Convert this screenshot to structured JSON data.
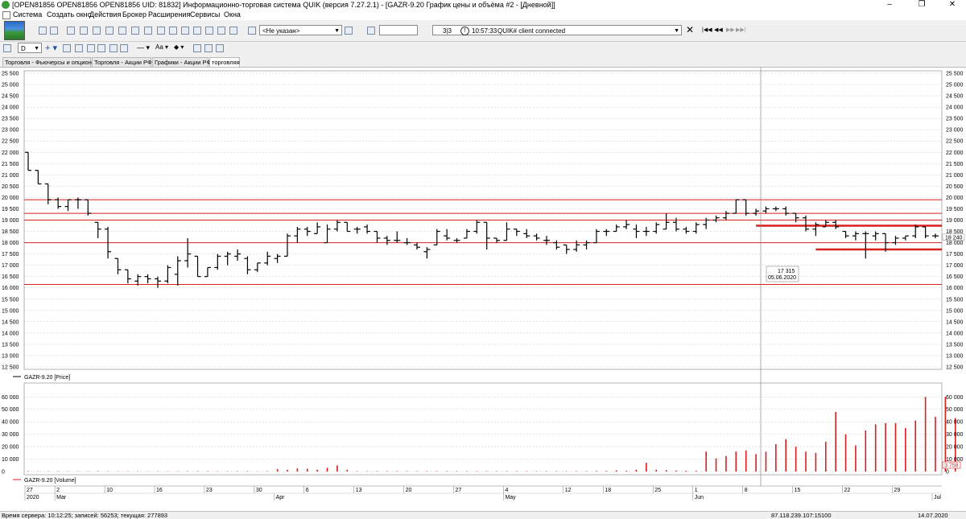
{
  "window": {
    "title": "[OPEN81856 OPEN81856 OPEN81856 UID: 81832] Информационно-торговая система QUIK (версия 7.27.2.1) - [GAZR-9.20 График цены и объёма #2 - [Дневной]]",
    "minimize": "–",
    "restore": "❐",
    "close": "✕"
  },
  "menu": [
    "Система",
    "Создать окно",
    "Действия",
    "Брокер",
    "Расширения",
    "Сервисы",
    "Окна"
  ],
  "toolbar": {
    "account_select": "<Не указан>",
    "search_value": "",
    "message_counter": "3|3",
    "message_time": "10:57:33",
    "message_text": "QUIK# client connected"
  },
  "toolbar2": {
    "interval": "D"
  },
  "tabs": [
    {
      "label": "Торговля - Фьючерсы и опционы",
      "active": false
    },
    {
      "label": "Торговля - Акции РФ",
      "active": false
    },
    {
      "label": "Графики - Акции РФ",
      "active": false
    },
    {
      "label": "торговляя",
      "active": true
    }
  ],
  "chart_data": [
    {
      "type": "ohlc",
      "legend": "GAZR-9.20 [Price]",
      "ylim": [
        12500,
        25500
      ],
      "y_ticks": [
        25500,
        25000,
        24500,
        24000,
        23500,
        23000,
        22500,
        22000,
        21500,
        21000,
        20500,
        20000,
        19500,
        19000,
        18500,
        18000,
        17500,
        17000,
        16500,
        16000,
        15500,
        15000,
        14500,
        14000,
        13500,
        13000,
        12500
      ],
      "right_axis_ticks": [
        25500,
        25000,
        24500,
        24000,
        23500,
        23000,
        22500,
        22000,
        21500,
        21000,
        20500,
        20000,
        19500,
        19000,
        18500,
        18000,
        17500,
        17000,
        16500,
        16000,
        15500,
        15000,
        14500,
        14000,
        13500,
        13000,
        12500
      ],
      "right_axis_labels": [
        "25 500",
        "25 000",
        "24 500",
        "24 000",
        "23 500",
        "23 000",
        "22 500",
        "22 000",
        "21 500",
        "21 000",
        "20 500",
        "20 000",
        "19 500",
        "19 000",
        "18 500",
        "18 000",
        "17 500",
        "17 000",
        "16 500",
        "16 000",
        "15 500",
        "15 000",
        "14 500",
        "14 000",
        "13 500",
        "13 000",
        "12 500"
      ],
      "last_price_label": "18 240",
      "last_price": 18240,
      "crosshair": {
        "value_label": "17 315",
        "date_label": "05.06.2020"
      },
      "horizontal_levels": [
        19900,
        19300,
        19000,
        18000,
        16150
      ],
      "horizontal_levels_thick": [
        {
          "value": 18750,
          "from_bar": 73,
          "to_bar": 82
        },
        {
          "value": 17700,
          "from_bar": 79,
          "to_bar": 83
        }
      ],
      "bars": [
        [
          22000,
          22000,
          21200,
          21200
        ],
        [
          21200,
          21200,
          20600,
          20600
        ],
        [
          20600,
          20600,
          19700,
          19900
        ],
        [
          19900,
          20000,
          19500,
          19600
        ],
        [
          19600,
          19900,
          19400,
          19900
        ],
        [
          19900,
          20000,
          19500,
          19900
        ],
        [
          19900,
          19900,
          19200,
          19300
        ],
        [
          18900,
          18900,
          18200,
          18600
        ],
        [
          18600,
          18700,
          17300,
          17600
        ],
        [
          17300,
          17300,
          16600,
          16800
        ],
        [
          16800,
          16800,
          16200,
          16400
        ],
        [
          16300,
          16600,
          16100,
          16500
        ],
        [
          16500,
          16600,
          16200,
          16400
        ],
        [
          16400,
          16500,
          16000,
          16300
        ],
        [
          16300,
          17000,
          16200,
          16900
        ],
        [
          16600,
          17400,
          16100,
          17200
        ],
        [
          17200,
          18200,
          16900,
          17500
        ],
        [
          17400,
          17400,
          16500,
          16500
        ],
        [
          16500,
          16900,
          16500,
          16900
        ],
        [
          16900,
          17500,
          16800,
          17400
        ],
        [
          17400,
          17600,
          17000,
          17500
        ],
        [
          17400,
          17700,
          17200,
          17500
        ],
        [
          17300,
          17400,
          16600,
          16800
        ],
        [
          16800,
          17100,
          16700,
          17100
        ],
        [
          17100,
          17600,
          17000,
          17400
        ],
        [
          17300,
          17500,
          17100,
          17400
        ],
        [
          17400,
          18400,
          17400,
          18300
        ],
        [
          18300,
          18700,
          18000,
          18600
        ],
        [
          18600,
          18700,
          18300,
          18500
        ],
        [
          18400,
          18900,
          18400,
          18700
        ],
        [
          18000,
          18800,
          18000,
          18600
        ],
        [
          18600,
          19000,
          18500,
          18900
        ],
        [
          18900,
          18900,
          18500,
          18500
        ],
        [
          18600,
          18700,
          18400,
          18600
        ],
        [
          18700,
          18800,
          18400,
          18500
        ],
        [
          18500,
          18500,
          18000,
          18200
        ],
        [
          18200,
          18300,
          17900,
          18100
        ],
        [
          18100,
          18500,
          18000,
          18100
        ],
        [
          18000,
          18200,
          17900,
          18000
        ],
        [
          17900,
          18000,
          17700,
          17800
        ],
        [
          17600,
          17800,
          17300,
          17700
        ],
        [
          17900,
          18600,
          17900,
          18500
        ],
        [
          18300,
          18600,
          18100,
          18200
        ],
        [
          18100,
          18200,
          18000,
          18100
        ],
        [
          18200,
          18600,
          18200,
          18500
        ],
        [
          18500,
          19000,
          18400,
          18900
        ],
        [
          18900,
          18900,
          17700,
          18200
        ],
        [
          18200,
          18200,
          18000,
          18100
        ],
        [
          18100,
          18900,
          18100,
          18600
        ],
        [
          18600,
          18600,
          18300,
          18500
        ],
        [
          18400,
          18600,
          18200,
          18300
        ],
        [
          18300,
          18400,
          18100,
          18200
        ],
        [
          18100,
          18300,
          17900,
          18100
        ],
        [
          18000,
          18100,
          17700,
          17800
        ],
        [
          17900,
          17900,
          17500,
          17700
        ],
        [
          17700,
          18100,
          17600,
          17900
        ],
        [
          17900,
          18100,
          17700,
          18000
        ],
        [
          18000,
          18600,
          18000,
          18500
        ],
        [
          18500,
          18600,
          18300,
          18500
        ],
        [
          18500,
          18800,
          18500,
          18700
        ],
        [
          18700,
          19000,
          18600,
          18800
        ],
        [
          18600,
          18800,
          18200,
          18500
        ],
        [
          18500,
          18700,
          18300,
          18500
        ],
        [
          18500,
          18900,
          18400,
          18800
        ],
        [
          18600,
          19300,
          18600,
          18900
        ],
        [
          18900,
          19100,
          18500,
          18600
        ],
        [
          18600,
          18700,
          18400,
          18500
        ],
        [
          18500,
          18900,
          18400,
          18800
        ],
        [
          18800,
          19100,
          18600,
          19000
        ],
        [
          19000,
          19200,
          18900,
          19100
        ],
        [
          19100,
          19400,
          19000,
          19300
        ],
        [
          19300,
          19900,
          19300,
          19900
        ],
        [
          19900,
          19900,
          19200,
          19300
        ],
        [
          19300,
          19500,
          19200,
          19400
        ],
        [
          19400,
          19600,
          19300,
          19500
        ],
        [
          19500,
          19600,
          19400,
          19500
        ],
        [
          19500,
          19600,
          19200,
          19300
        ],
        [
          19300,
          19300,
          18900,
          19100
        ],
        [
          19100,
          19200,
          18500,
          18600
        ],
        [
          18600,
          18900,
          18300,
          18800
        ],
        [
          18700,
          19000,
          18700,
          18900
        ],
        [
          18900,
          19000,
          18600,
          18700
        ],
        [
          18500,
          18500,
          18200,
          18300
        ],
        [
          18300,
          18500,
          18100,
          18400
        ],
        [
          18400,
          18500,
          17300,
          18400
        ],
        [
          18300,
          18500,
          18100,
          18400
        ],
        [
          18400,
          18400,
          17600,
          18000
        ],
        [
          18000,
          18300,
          17900,
          18200
        ],
        [
          18200,
          18300,
          18100,
          18300
        ],
        [
          18300,
          18800,
          18200,
          18700
        ],
        [
          18700,
          18700,
          18200,
          18300
        ],
        [
          18300,
          18400,
          18200,
          18300
        ]
      ]
    },
    {
      "type": "bar",
      "legend": "GAZR-9.20 [Volume]",
      "ylim": [
        0,
        66000
      ],
      "y_ticks": [
        60000,
        50000,
        40000,
        30000,
        20000,
        10000,
        0
      ],
      "right_axis_labels": [
        "60 000",
        "50 000",
        "40 000",
        "30 000",
        "20 000",
        "10 000",
        "0"
      ],
      "last_value_label": "3 758",
      "values": [
        300,
        200,
        200,
        300,
        200,
        200,
        200,
        300,
        200,
        200,
        200,
        200,
        200,
        200,
        200,
        200,
        300,
        300,
        300,
        200,
        300,
        300,
        300,
        200,
        300,
        2000,
        1500,
        2500,
        2200,
        1500,
        3000,
        5000,
        1500,
        300,
        300,
        300,
        300,
        300,
        300,
        300,
        300,
        300,
        300,
        300,
        300,
        300,
        300,
        300,
        300,
        300,
        300,
        300,
        300,
        300,
        300,
        300,
        300,
        400,
        500,
        1000,
        600,
        1500,
        7000,
        1500,
        1200,
        800,
        700,
        600,
        16000,
        10500,
        12500,
        16000,
        17000,
        14000,
        16000,
        22000,
        26000,
        20000,
        16000,
        15000,
        24000,
        48000,
        30000,
        21000,
        33000,
        38000,
        39000,
        39000,
        35000,
        41000,
        60000,
        44000,
        60000,
        43000
      ]
    }
  ],
  "x_axis": {
    "days": [
      "27",
      "2",
      "10",
      "16",
      "23",
      "30",
      "6",
      "13",
      "20",
      "27",
      "4",
      "12",
      "18",
      "25",
      "1",
      "8",
      "15",
      "22",
      "29"
    ],
    "months": [
      "2020",
      "Mar",
      "Apr",
      "May",
      "Jun",
      "Jul"
    ]
  },
  "status": {
    "server_time": "Время сервера: 10:12:25; записей: 56253; текущая: 277893",
    "connection": "87.118.239.107:15100",
    "date": "14.07.2020"
  },
  "colors": {
    "bar": "#000000",
    "level_line": "#d81e1e",
    "volume_bar": "#d81e1e",
    "grid": "#c8c8c8",
    "label_red": "#d81e1e"
  }
}
